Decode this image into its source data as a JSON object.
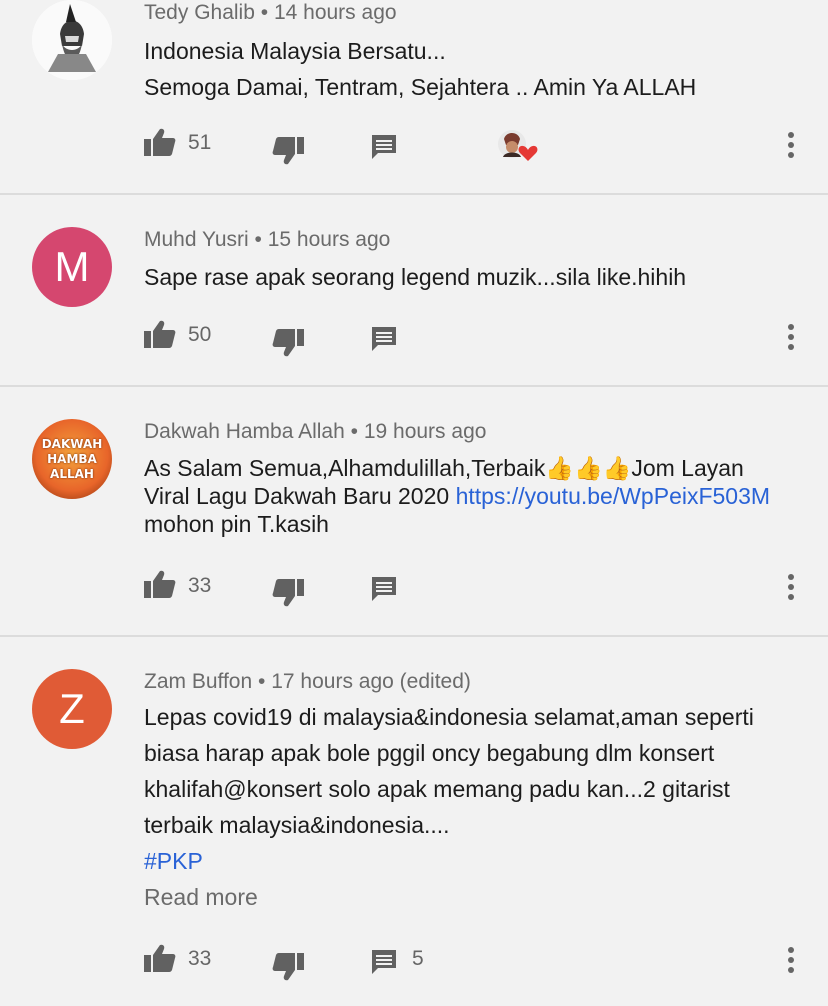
{
  "comments": [
    {
      "author": "Tedy Ghalib",
      "time": "14 hours ago",
      "lines": [
        "Indonesia Malaysia Bersatu...",
        "Semoga Damai,  Tentram,  Sejahtera .. Amin Ya ALLAH"
      ],
      "likes": "51",
      "creator_heart": true,
      "avatar_icon": "bearded-man-avatar"
    },
    {
      "author": "Muhd Yusri",
      "time": "15 hours ago",
      "lines": [
        "Sape rase apak seorang legend muzik...sila like.hihih"
      ],
      "likes": "50",
      "avatar_letter": "M",
      "avatar_color": "#d5476f"
    },
    {
      "author": "Dakwah Hamba Allah",
      "time": "19 hours ago",
      "text_before": "As Salam Semua,Alhamdulillah,Terbaik👍👍👍Jom Layan Viral Lagu Dakwah Baru 2020 ",
      "link": "https://youtu.be/WpPeixF503M",
      "text_after": " mohon pin T.kasih",
      "likes": "33",
      "avatar_lines": [
        "DAKWAH",
        "HAMBA",
        "ALLAH"
      ],
      "avatar_colors": [
        "#e8652a",
        "#f3a23b"
      ]
    },
    {
      "author": "Zam Buffon",
      "time": "17 hours ago",
      "edited": "(edited)",
      "text": "Lepas covid19  di malaysia&indonesia selamat,aman seperti biasa harap apak bole pggil oncy begabung dlm konsert khalifah@konsert solo apak memang padu kan...2 gitarist terbaik malaysia&indonesia....",
      "hashtag": "#PKP",
      "read_more": "Read more",
      "likes": "33",
      "replies": "5",
      "avatar_letter": "Z",
      "avatar_color": "#e05b36"
    }
  ],
  "separator": "•",
  "icons": [
    "thumbs-up-icon",
    "thumbs-down-icon",
    "reply-icon",
    "more-vertical-icon",
    "heart-icon"
  ],
  "colors": {
    "background": "#f2f2f2",
    "link": "#2962d6",
    "heart": "#e53935"
  }
}
